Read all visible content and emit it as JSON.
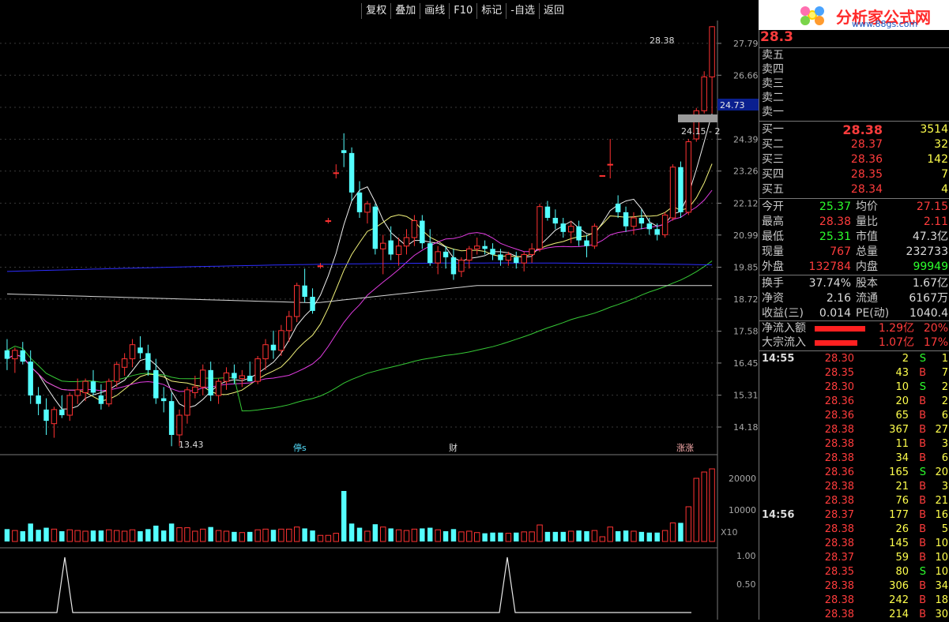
{
  "toolbar": {
    "items": [
      "复权",
      "叠加",
      "画线",
      "F10",
      "标记",
      "-自选",
      "返回"
    ]
  },
  "logo": {
    "title": "分析家公式网",
    "url": "www.88gs.com"
  },
  "price_axis": [
    "27.79",
    "26.66",
    "25.52",
    "24.39",
    "23.26",
    "22.12",
    "20.99",
    "19.85",
    "18.72",
    "17.58",
    "16.45",
    "15.31",
    "14.18"
  ],
  "price_marker": "24.73",
  "volume_axis": [
    "20000",
    "10000"
  ],
  "volume_scale_label": "X10",
  "indicator_axis": [
    "1.00",
    "0.50"
  ],
  "annotations": {
    "high_label": "28.38",
    "low_label": "13.43",
    "mid_label": "24.15 - 2",
    "event_tings": "停s",
    "event_cai": "财",
    "event_zhang": "涨涨"
  },
  "quote": {
    "last": "28.3",
    "sell": [
      {
        "label": "卖五"
      },
      {
        "label": "卖四"
      },
      {
        "label": "卖三"
      },
      {
        "label": "卖二"
      },
      {
        "label": "卖一"
      }
    ],
    "buy": [
      {
        "label": "买一",
        "price": "28.38",
        "vol": "3514"
      },
      {
        "label": "买二",
        "price": "28.37",
        "vol": "32"
      },
      {
        "label": "买三",
        "price": "28.36",
        "vol": "142"
      },
      {
        "label": "买四",
        "price": "28.35",
        "vol": "7"
      },
      {
        "label": "买五",
        "price": "28.34",
        "vol": "4"
      }
    ],
    "stats": [
      {
        "l1": "今开",
        "v1": "25.37",
        "c1": "green",
        "l2": "均价",
        "v2": "27.15",
        "c2": "red"
      },
      {
        "l1": "最高",
        "v1": "28.38",
        "c1": "red",
        "l2": "量比",
        "v2": "2.11",
        "c2": "red"
      },
      {
        "l1": "最低",
        "v1": "25.31",
        "c1": "green",
        "l2": "市值",
        "v2": "47.3亿",
        "c2": "white"
      },
      {
        "l1": "现量",
        "v1": "767",
        "c1": "red",
        "l2": "总量",
        "v2": "232733",
        "c2": "white"
      },
      {
        "l1": "外盘",
        "v1": "132784",
        "c1": "red",
        "l2": "内盘",
        "v2": "99949",
        "c2": "green"
      }
    ],
    "stats2": [
      {
        "l1": "换手",
        "v1": "37.74%",
        "l2": "股本",
        "v2": "1.67亿"
      },
      {
        "l1": "净资",
        "v1": "2.16",
        "l2": "流通",
        "v2": "6167万"
      },
      {
        "l1": "收益(三)",
        "v1": "0.014",
        "l2": "PE(动)",
        "v2": "1040.4"
      }
    ],
    "flows": [
      {
        "label": "净流入额",
        "value": "1.29亿",
        "pct": "20%",
        "bar_fraction": 0.8
      },
      {
        "label": "大宗流入",
        "value": "1.07亿",
        "pct": "17%",
        "bar_fraction": 0.68
      }
    ]
  },
  "ticks": [
    {
      "time": "14:55",
      "price": "28.30",
      "vol": "2",
      "side": "S",
      "n": "1"
    },
    {
      "time": "",
      "price": "28.35",
      "vol": "43",
      "side": "B",
      "n": "7"
    },
    {
      "time": "",
      "price": "28.30",
      "vol": "10",
      "side": "S",
      "n": "2"
    },
    {
      "time": "",
      "price": "28.36",
      "vol": "20",
      "side": "B",
      "n": "2"
    },
    {
      "time": "",
      "price": "28.36",
      "vol": "65",
      "side": "B",
      "n": "6"
    },
    {
      "time": "",
      "price": "28.38",
      "vol": "367",
      "side": "B",
      "n": "27"
    },
    {
      "time": "",
      "price": "28.38",
      "vol": "11",
      "side": "B",
      "n": "3"
    },
    {
      "time": "",
      "price": "28.38",
      "vol": "34",
      "side": "B",
      "n": "6"
    },
    {
      "time": "",
      "price": "28.36",
      "vol": "165",
      "side": "S",
      "n": "20"
    },
    {
      "time": "",
      "price": "28.38",
      "vol": "21",
      "side": "B",
      "n": "3"
    },
    {
      "time": "",
      "price": "28.38",
      "vol": "76",
      "side": "B",
      "n": "21"
    },
    {
      "time": "14:56",
      "price": "28.37",
      "vol": "177",
      "side": "B",
      "n": "16"
    },
    {
      "time": "",
      "price": "28.38",
      "vol": "26",
      "side": "B",
      "n": "5"
    },
    {
      "time": "",
      "price": "28.38",
      "vol": "145",
      "side": "B",
      "n": "10"
    },
    {
      "time": "",
      "price": "28.37",
      "vol": "59",
      "side": "B",
      "n": "10"
    },
    {
      "time": "",
      "price": "28.35",
      "vol": "80",
      "side": "S",
      "n": "10"
    },
    {
      "time": "",
      "price": "28.38",
      "vol": "306",
      "side": "B",
      "n": "34"
    },
    {
      "time": "",
      "price": "28.38",
      "vol": "242",
      "side": "B",
      "n": "18"
    },
    {
      "time": "",
      "price": "28.38",
      "vol": "214",
      "side": "B",
      "n": "30"
    }
  ],
  "chart_data": {
    "type": "candlestick",
    "ylim": [
      13.2,
      28.6
    ],
    "candles": [
      [
        16.9,
        17.3,
        16.2,
        16.6
      ],
      [
        16.6,
        17.0,
        16.1,
        16.9
      ],
      [
        16.9,
        17.2,
        16.4,
        16.5
      ],
      [
        16.5,
        16.9,
        15.0,
        15.3
      ],
      [
        15.3,
        15.6,
        14.6,
        15.0
      ],
      [
        14.8,
        15.2,
        13.9,
        14.4
      ],
      [
        14.3,
        14.9,
        13.8,
        14.8
      ],
      [
        14.8,
        15.3,
        14.5,
        14.6
      ],
      [
        14.6,
        15.4,
        14.4,
        15.3
      ],
      [
        15.3,
        15.9,
        15.0,
        15.5
      ],
      [
        15.4,
        15.9,
        15.1,
        15.8
      ],
      [
        15.8,
        16.2,
        15.3,
        15.4
      ],
      [
        15.3,
        15.7,
        14.8,
        15.0
      ],
      [
        15.0,
        15.9,
        14.9,
        15.8
      ],
      [
        15.8,
        16.5,
        15.6,
        16.4
      ],
      [
        16.3,
        16.8,
        16.0,
        16.6
      ],
      [
        16.6,
        17.3,
        16.3,
        17.1
      ],
      [
        17.0,
        17.4,
        16.6,
        16.8
      ],
      [
        16.8,
        17.1,
        16.0,
        16.2
      ],
      [
        16.2,
        16.6,
        15.0,
        15.2
      ],
      [
        15.2,
        15.6,
        14.7,
        15.1
      ],
      [
        15.1,
        15.4,
        13.5,
        13.9
      ],
      [
        13.9,
        14.8,
        13.5,
        14.6
      ],
      [
        14.6,
        15.6,
        14.3,
        15.5
      ],
      [
        15.4,
        16.0,
        15.2,
        15.6
      ],
      [
        15.6,
        16.4,
        15.3,
        16.2
      ],
      [
        16.2,
        16.5,
        15.1,
        15.3
      ],
      [
        15.3,
        15.9,
        15.0,
        15.8
      ],
      [
        15.8,
        16.3,
        15.5,
        16.1
      ],
      [
        16.1,
        16.4,
        15.7,
        15.9
      ],
      [
        15.9,
        16.2,
        15.6,
        16.0
      ],
      [
        16.0,
        16.5,
        15.8,
        15.8
      ],
      [
        15.8,
        16.7,
        15.7,
        16.6
      ],
      [
        16.6,
        17.3,
        16.2,
        17.1
      ],
      [
        17.1,
        17.6,
        16.6,
        16.9
      ],
      [
        16.9,
        17.8,
        16.7,
        17.6
      ],
      [
        17.6,
        18.3,
        17.2,
        18.1
      ],
      [
        18.1,
        19.3,
        17.9,
        19.2
      ],
      [
        19.2,
        19.8,
        18.6,
        18.8
      ],
      [
        18.8,
        19.1,
        18.2,
        18.3
      ],
      [
        19.9,
        20.0,
        19.8,
        19.9
      ],
      [
        21.5,
        21.6,
        21.4,
        21.5
      ],
      [
        23.2,
        23.5,
        23.0,
        23.2
      ],
      [
        24.0,
        24.6,
        23.4,
        23.9
      ],
      [
        23.9,
        24.1,
        22.2,
        22.5
      ],
      [
        22.5,
        22.9,
        21.6,
        21.8
      ],
      [
        21.8,
        22.2,
        21.4,
        22.1
      ],
      [
        22.0,
        22.1,
        20.3,
        20.5
      ],
      [
        20.5,
        21.0,
        19.6,
        20.7
      ],
      [
        20.8,
        21.3,
        20.1,
        20.3
      ],
      [
        20.3,
        20.9,
        19.9,
        20.6
      ],
      [
        20.6,
        21.2,
        20.3,
        20.9
      ],
      [
        20.9,
        21.7,
        20.6,
        21.5
      ],
      [
        21.5,
        21.7,
        20.5,
        20.7
      ],
      [
        20.7,
        21.2,
        19.9,
        20.0
      ],
      [
        20.0,
        20.6,
        19.6,
        20.4
      ],
      [
        20.4,
        20.6,
        19.8,
        20.2
      ],
      [
        20.2,
        20.5,
        19.4,
        19.6
      ],
      [
        19.7,
        20.2,
        19.5,
        20.1
      ],
      [
        20.1,
        20.6,
        19.8,
        20.5
      ],
      [
        20.5,
        20.9,
        20.3,
        20.6
      ],
      [
        20.6,
        20.8,
        20.3,
        20.5
      ],
      [
        20.5,
        20.7,
        20.1,
        20.3
      ],
      [
        20.3,
        20.5,
        19.9,
        20.1
      ],
      [
        20.1,
        20.4,
        19.9,
        20.3
      ],
      [
        20.2,
        20.4,
        19.8,
        20.0
      ],
      [
        20.0,
        20.4,
        19.7,
        20.3
      ],
      [
        20.3,
        20.7,
        20.0,
        20.5
      ],
      [
        20.5,
        22.1,
        20.4,
        22.0
      ],
      [
        22.0,
        22.2,
        21.5,
        21.6
      ],
      [
        21.6,
        21.9,
        21.2,
        21.4
      ],
      [
        21.4,
        21.6,
        20.9,
        21.1
      ],
      [
        21.1,
        21.5,
        20.7,
        21.3
      ],
      [
        21.3,
        21.5,
        20.6,
        20.8
      ],
      [
        20.8,
        21.0,
        20.2,
        20.6
      ],
      [
        20.6,
        21.4,
        20.5,
        21.3
      ],
      [
        23.1,
        23.1,
        23.1,
        23.1
      ],
      [
        23.5,
        24.4,
        23.0,
        23.5
      ],
      [
        22.1,
        22.4,
        21.6,
        21.8
      ],
      [
        21.8,
        22.0,
        21.1,
        21.3
      ],
      [
        21.3,
        21.8,
        21.0,
        21.6
      ],
      [
        21.6,
        21.9,
        21.2,
        21.4
      ],
      [
        21.4,
        21.6,
        21.0,
        21.2
      ],
      [
        21.2,
        21.4,
        20.8,
        21.0
      ],
      [
        21.0,
        21.8,
        20.9,
        21.7
      ],
      [
        21.6,
        23.5,
        21.5,
        23.4
      ],
      [
        23.4,
        23.6,
        21.6,
        21.8
      ],
      [
        21.8,
        24.4,
        21.7,
        24.3
      ],
      [
        24.4,
        25.5,
        24.3,
        25.4
      ],
      [
        25.4,
        26.8,
        25.3,
        26.6
      ],
      [
        26.6,
        28.4,
        25.3,
        28.38
      ]
    ]
  }
}
